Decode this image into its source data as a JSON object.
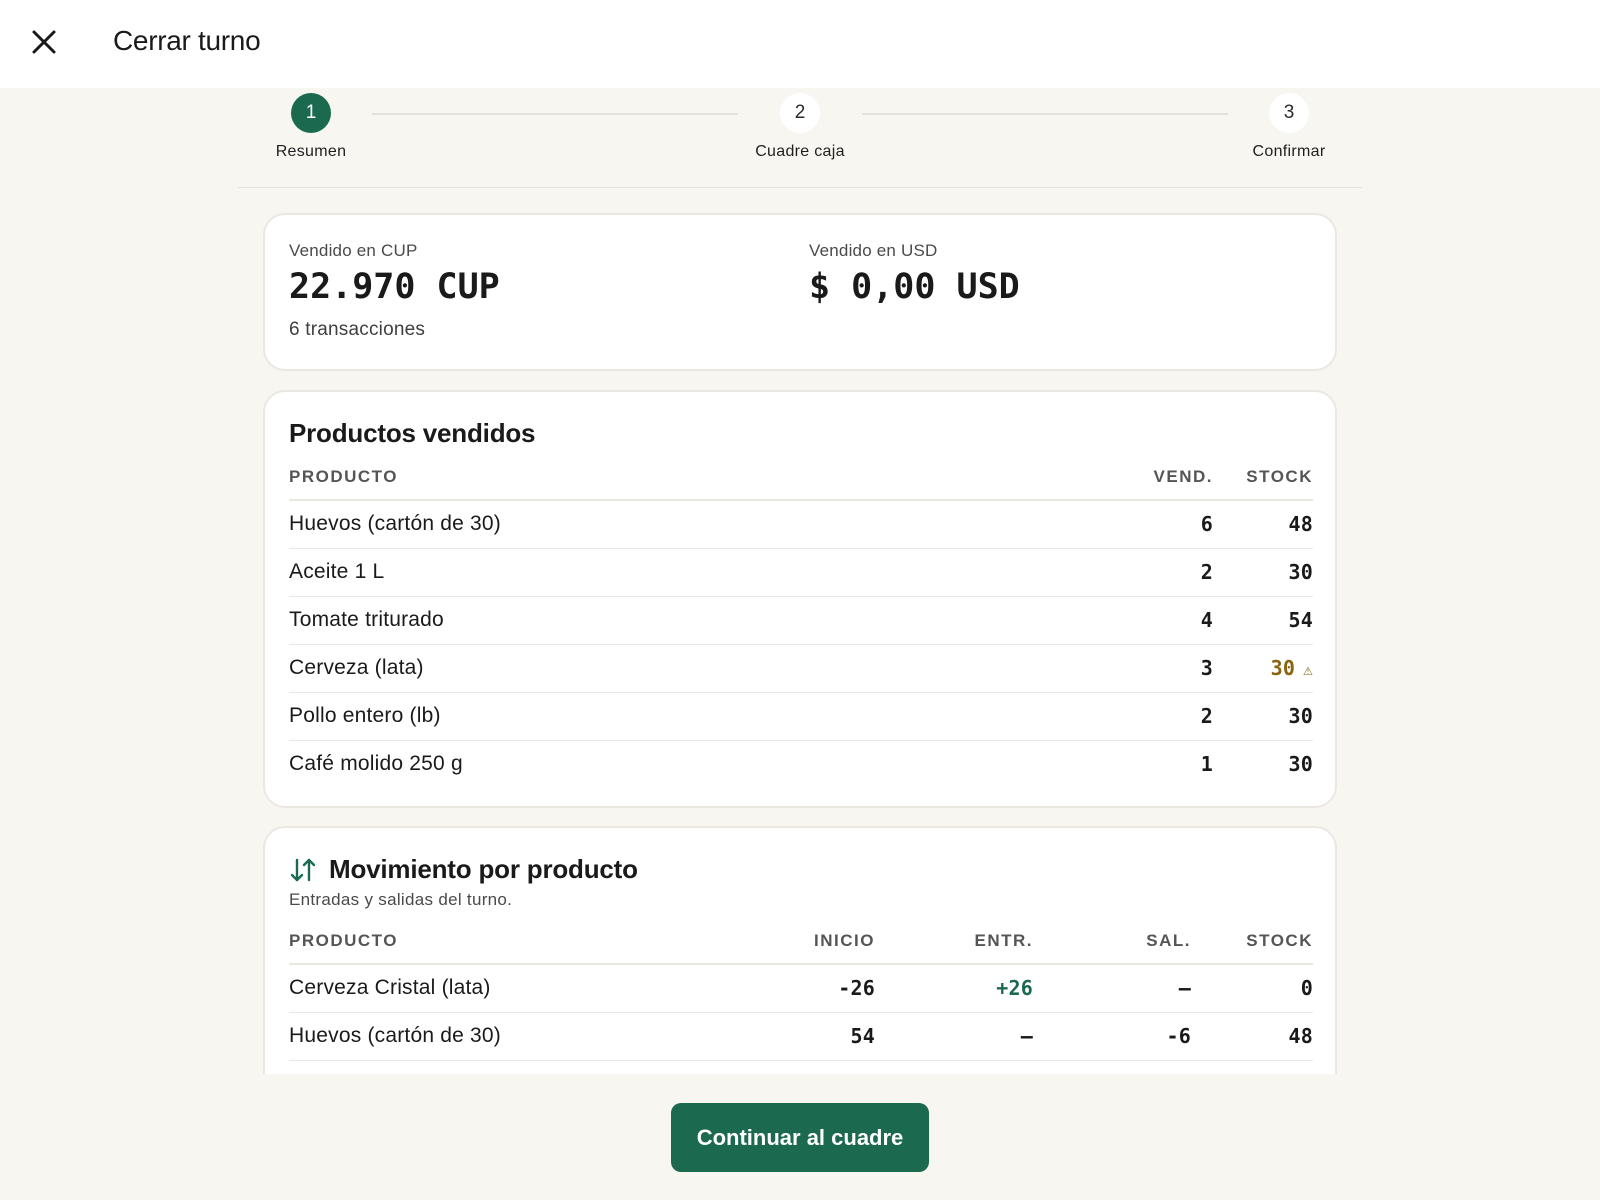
{
  "header": {
    "title": "Cerrar turno",
    "close_icon": "close-icon"
  },
  "stepper": {
    "steps": [
      {
        "number": "1",
        "label": "Resumen",
        "active": true
      },
      {
        "number": "2",
        "label": "Cuadre caja",
        "active": false
      },
      {
        "number": "3",
        "label": "Confirmar",
        "active": false
      }
    ]
  },
  "sales": {
    "cup": {
      "label": "Vendido en CUP",
      "value": "22.970 CUP",
      "sub": "6 transacciones"
    },
    "usd": {
      "label": "Vendido en USD",
      "value": "$ 0,00 USD"
    }
  },
  "products": {
    "title": "Productos vendidos",
    "columns": {
      "product": "PRODUCTO",
      "sold": "VEND.",
      "stock": "STOCK"
    },
    "rows": [
      {
        "name": "Huevos (cartón de 30)",
        "sold": "6",
        "stock": "48"
      },
      {
        "name": "Aceite 1 L",
        "sold": "2",
        "stock": "30"
      },
      {
        "name": "Tomate triturado",
        "sold": "4",
        "stock": "54"
      },
      {
        "name": "Cerveza (lata)",
        "sold": "3",
        "stock": "30",
        "low_stock": true,
        "warning_icon": "warning-icon"
      },
      {
        "name": "Pollo entero (lb)",
        "sold": "2",
        "stock": "30"
      },
      {
        "name": "Café molido 250 g",
        "sold": "1",
        "stock": "30"
      }
    ]
  },
  "movement": {
    "icon": "swap-vertical-icon",
    "title": "Movimiento por producto",
    "subtitle": "Entradas y salidas del turno.",
    "columns": {
      "product": "PRODUCTO",
      "start": "INICIO",
      "in": "ENTR.",
      "out": "SAL.",
      "stock": "STOCK"
    },
    "rows": [
      {
        "name": "Cerveza Cristal (lata)",
        "start": "-26",
        "in": "+26",
        "out": "–",
        "stock": "0"
      },
      {
        "name": "Huevos (cartón de 30)",
        "start": "54",
        "in": "–",
        "out": "-6",
        "stock": "48"
      }
    ]
  },
  "footer": {
    "continue_label": "Continuar al cuadre"
  },
  "colors": {
    "accent": "#1b6a4f",
    "warning": "#8a6410",
    "background": "#f8f6f1"
  }
}
